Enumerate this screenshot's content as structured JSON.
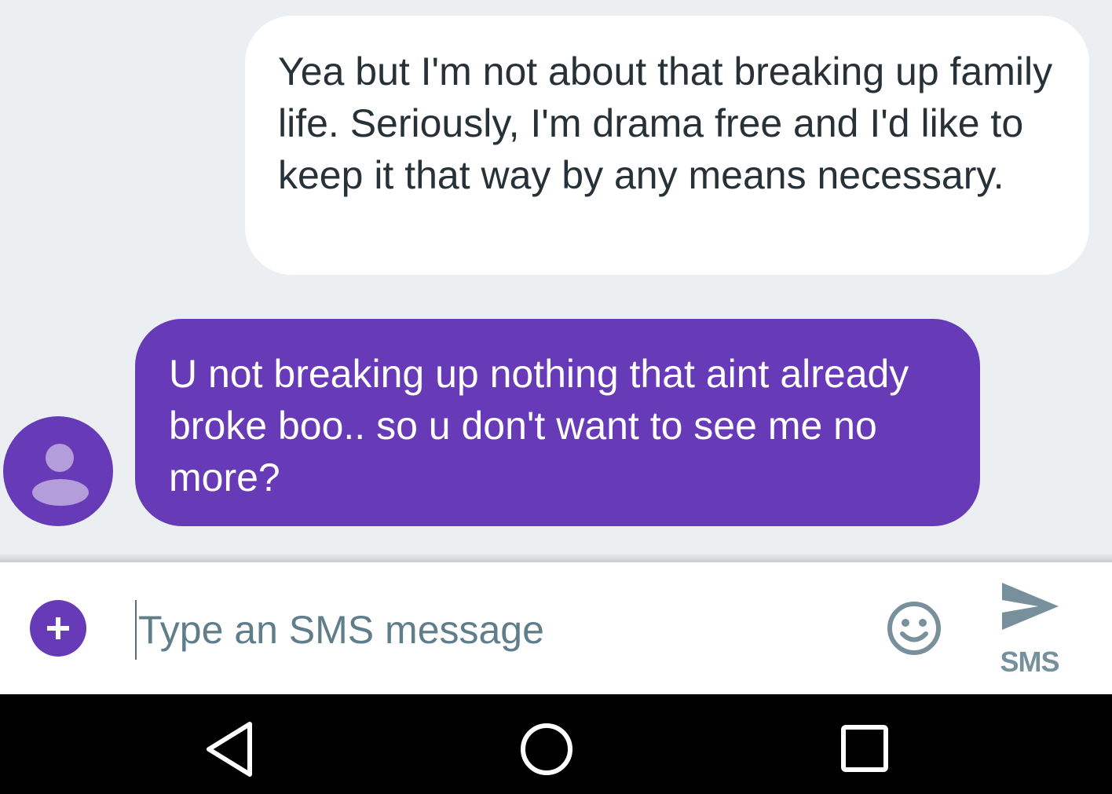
{
  "conversation": {
    "messages": [
      {
        "direction": "outgoing",
        "text": "Yea but I'm not about that breaking up family life. Seriously, I'm drama free and I'd like to keep it that way by any means necessary."
      },
      {
        "direction": "incoming",
        "text": "U not breaking up nothing that aint already broke boo.. so u don't want to see me no more?"
      }
    ]
  },
  "compose": {
    "placeholder": "Type an SMS message",
    "send_label": "SMS"
  },
  "icons": {
    "attach": "plus-icon",
    "emoji": "smiley-face-icon",
    "send": "send-arrow-icon",
    "avatar": "person-silhouette-icon",
    "back": "triangle-back-icon",
    "home": "circle-home-icon",
    "recents": "square-recents-icon"
  },
  "colors": {
    "accent": "#673ab7",
    "avatar_figure": "#b39ddb",
    "conversation_bg": "#eceff1",
    "outgoing_bubble": "#ffffff",
    "outgoing_text": "#263238",
    "incoming_text": "#ffffff",
    "compose_text": "#546e7a",
    "send_icon": "#78909c",
    "navbar_bg": "#000000"
  }
}
